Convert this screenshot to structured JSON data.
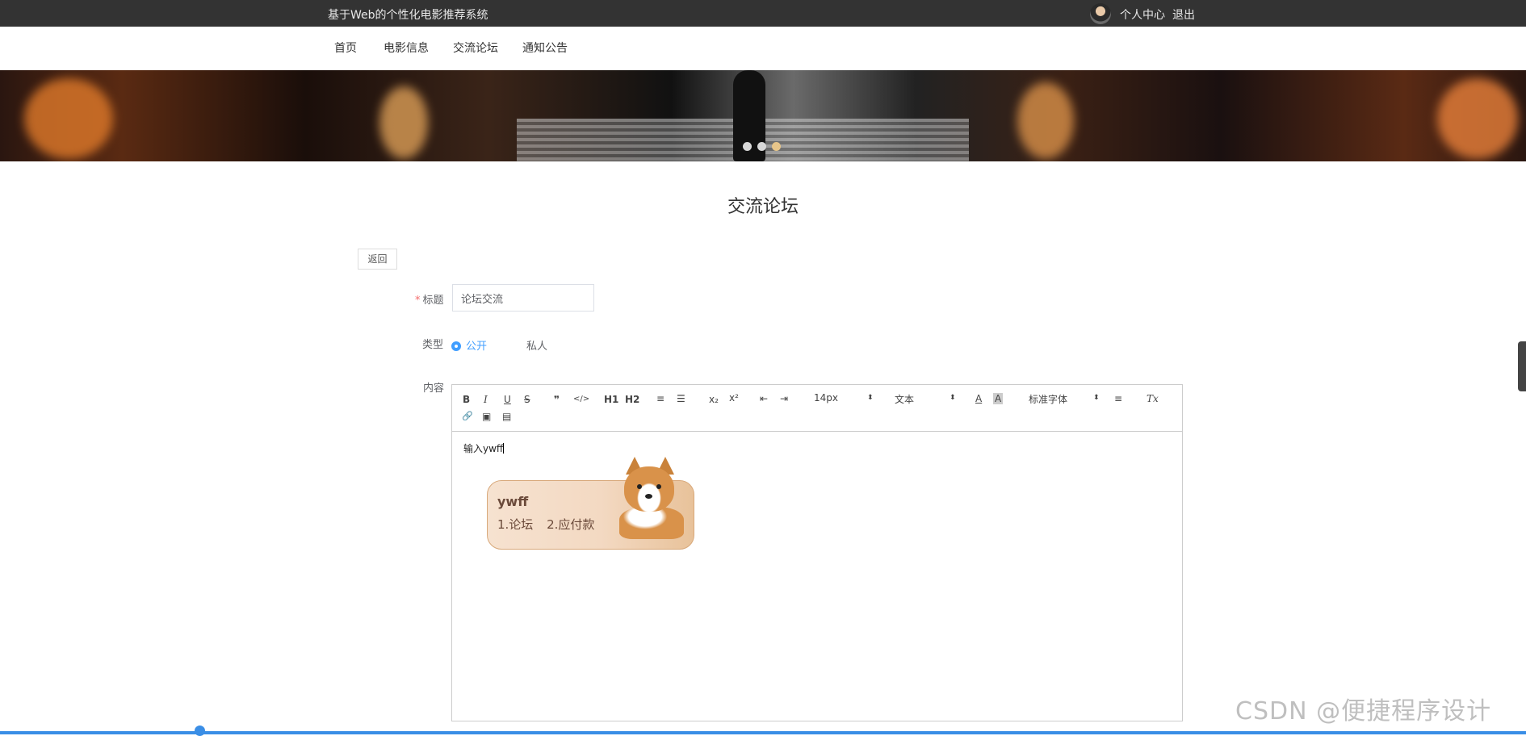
{
  "header": {
    "site_title": "基于Web的个性化电影推荐系统",
    "personal_center": "个人中心",
    "logout": "退出"
  },
  "nav": {
    "items": [
      "首页",
      "电影信息",
      "交流论坛",
      "通知公告"
    ]
  },
  "banner": {
    "slides": 3,
    "active_slide": 3
  },
  "page": {
    "title": "交流论坛",
    "back_label": "返回"
  },
  "form": {
    "title_label": "标题",
    "title_value": "论坛交流",
    "type_label": "类型",
    "type_options": [
      "公开",
      "私人"
    ],
    "type_selected": "公开",
    "content_label": "内容",
    "editor": {
      "toolbar": {
        "bold": "B",
        "italic": "I",
        "underline": "U",
        "strike": "S",
        "blockquote": "❞",
        "code": "</>",
        "h1": "H1",
        "h2": "H2",
        "ordered_list": "≡",
        "bullet_list": "☰",
        "subscript": "x₂",
        "superscript": "x²",
        "outdent": "⇤",
        "indent": "⇥",
        "size": "14px",
        "header": "文本",
        "color": "A",
        "background": "A",
        "font": "标准字体",
        "align": "≡",
        "clean": "Tx",
        "link": "🔗",
        "image": "▣",
        "video": "▤"
      },
      "content": "输入ywff"
    }
  },
  "ime": {
    "composition": "ywff",
    "candidates": [
      "1.论坛",
      "2.应付款"
    ]
  },
  "watermark": "CSDN @便捷程序设计",
  "colors": {
    "accent": "#409eff",
    "topbar": "#333333"
  }
}
